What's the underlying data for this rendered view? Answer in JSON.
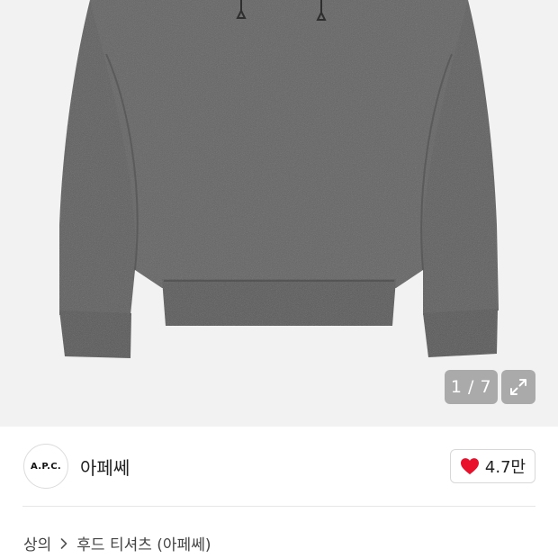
{
  "gallery": {
    "counter": "1 / 7",
    "product_image_icon": "hoodie-product-image",
    "expand_icon": "expand-arrows-icon"
  },
  "brand": {
    "logo_text": "A.P.C.",
    "name": "아페쎄"
  },
  "like": {
    "icon": "heart-icon",
    "count": "4.7만",
    "color": "#e8102a"
  },
  "breadcrumb": {
    "category": "상의",
    "separator_icon": "chevron-right-icon",
    "subcategory": "후드 티셔츠 (아페쎄)"
  }
}
